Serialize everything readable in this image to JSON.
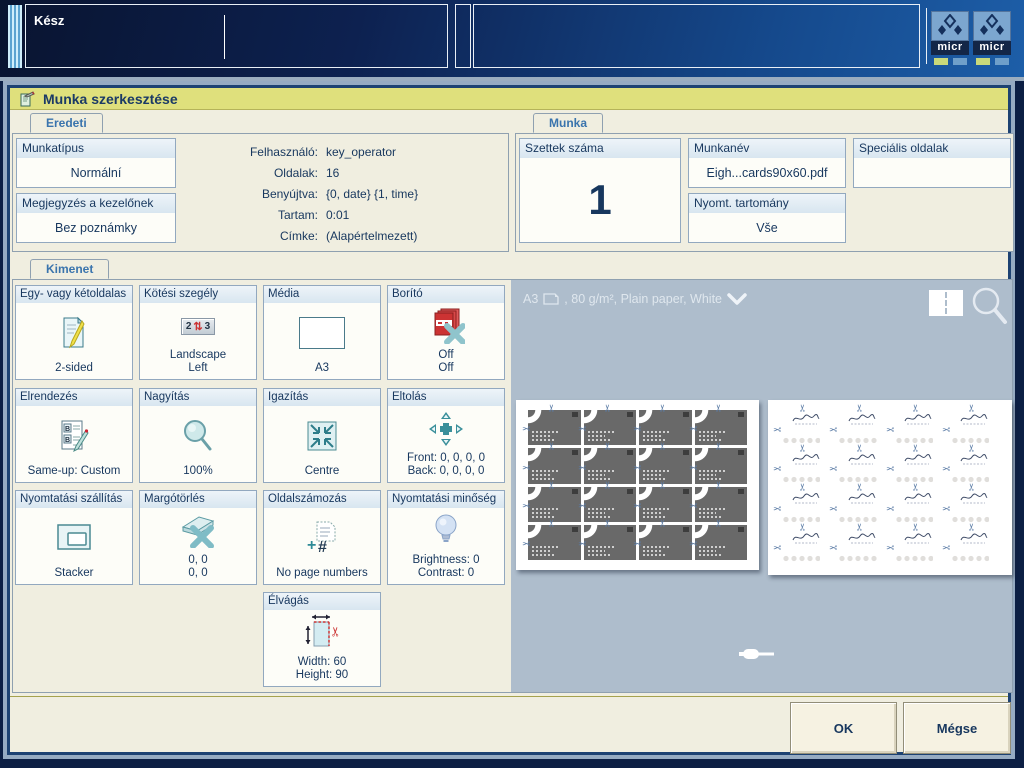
{
  "top_bar": {
    "status": "Kész",
    "logos": [
      {
        "text": "micr"
      },
      {
        "text": "micr"
      }
    ]
  },
  "header": {
    "title": "Munka szerkesztése"
  },
  "eredeti": {
    "tab": "Eredeti",
    "munkatipus": {
      "label": "Munkatípus",
      "value": "Normální"
    },
    "megjegyzes": {
      "label": "Megjegyzés a kezelőnek",
      "value": "Bez poznámky"
    },
    "info": [
      {
        "label": "Felhasználó:",
        "value": "key_operator"
      },
      {
        "label": "Oldalak:",
        "value": "16"
      },
      {
        "label": "Benyújtva:",
        "value": "{0, date} {1, time}"
      },
      {
        "label": "Tartam:",
        "value": "0:01"
      },
      {
        "label": "Címke:",
        "value": "(Alapértelmezett)"
      }
    ]
  },
  "munka": {
    "tab": "Munka",
    "szettek": {
      "label": "Szettek száma",
      "value": "1"
    },
    "munkanev": {
      "label": "Munkanév",
      "value": "Eigh...cards90x60.pdf"
    },
    "tartomany": {
      "label": "Nyomt. tartomány",
      "value": "Vše"
    },
    "specialis": {
      "label": "Speciális oldalak",
      "value": ""
    }
  },
  "kimenet": {
    "tab": "Kimenet",
    "buttons": [
      {
        "label": "Egy- vagy kétoldalas",
        "value": "2-sided",
        "icon": "two-sided-icon"
      },
      {
        "label": "Kötési szegély",
        "value": "Landscape",
        "value2": "Left",
        "icon": "binding-edge-icon",
        "badge_left": "2",
        "badge_right": "3",
        "badge_mid": "⇅"
      },
      {
        "label": "Média",
        "value": "A3",
        "icon": "media-icon"
      },
      {
        "label": "Borító",
        "value": "Off",
        "value2": "Off",
        "icon": "cover-icon"
      },
      {
        "label": "Elrendezés",
        "value": "Same-up: Custom",
        "icon": "layout-icon"
      },
      {
        "label": "Nagyítás",
        "value": "100%",
        "icon": "magnifier-icon"
      },
      {
        "label": "Igazítás",
        "value": "Centre",
        "icon": "align-centre-icon"
      },
      {
        "label": "Eltolás",
        "value": "Front: 0, 0, 0, 0",
        "value2": "Back: 0, 0, 0, 0",
        "icon": "shift-icon"
      },
      {
        "label": "Nyomtatási szállítás",
        "value": "Stacker",
        "icon": "stacker-icon"
      },
      {
        "label": "Margótörlés",
        "value": "0, 0",
        "value2": "0, 0",
        "icon": "margin-erase-icon"
      },
      {
        "label": "Oldalszámozás",
        "value": "No page numbers",
        "icon": "page-numbers-icon"
      },
      {
        "label": "Nyomtatási minőség",
        "value": "Brightness: 0",
        "value2": "Contrast: 0",
        "icon": "bulb-icon"
      },
      {
        "label": "Élvágás",
        "value": "Width: 60",
        "value2": "Height: 90",
        "icon": "trim-icon"
      }
    ]
  },
  "preview": {
    "media_prefix": "A3",
    "media_rest": ", 80 g/m², Plain paper, White",
    "grid": {
      "rows": 4,
      "cols": 4
    },
    "colors": {
      "background": "#aebdcc",
      "card_front": "#696969",
      "crop_mark": "#5b7ca6"
    }
  },
  "footer": {
    "ok": "OK",
    "cancel": "Mégse"
  }
}
